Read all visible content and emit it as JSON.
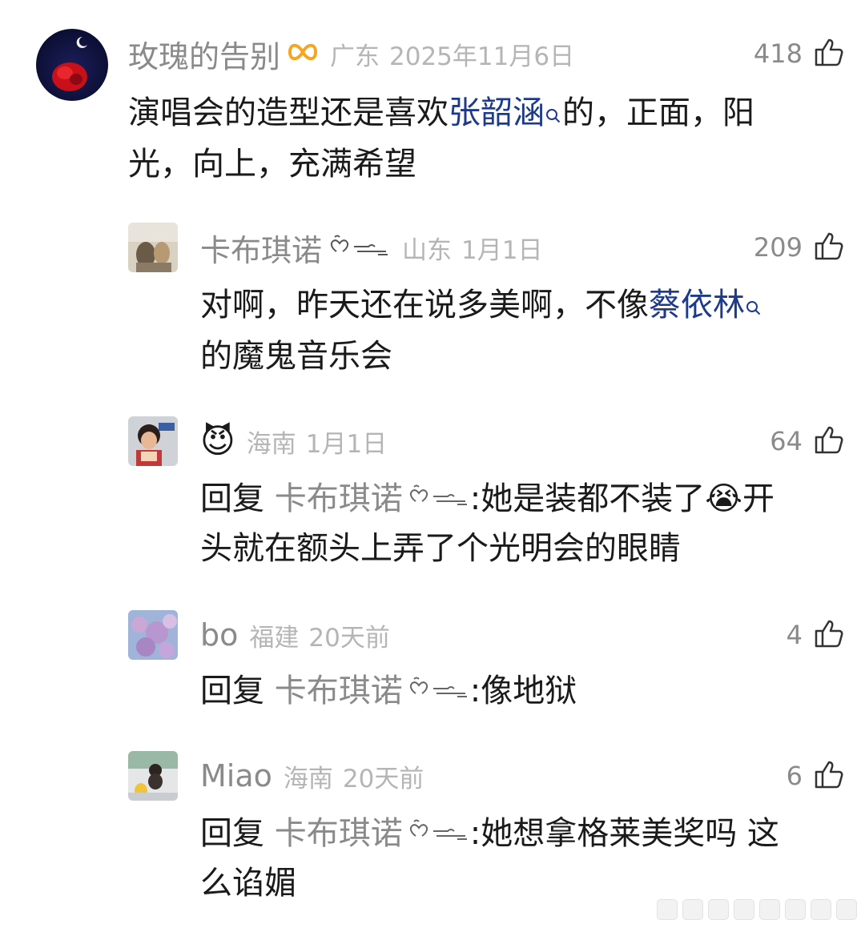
{
  "comments": [
    {
      "username": "玫瑰的告别",
      "location": "广东",
      "date": "2025年11月6日",
      "likes": "418",
      "text_before": "演唱会的造型还是喜欢",
      "mention": "张韶涵",
      "text_after": "的，正面，阳",
      "text_line2": "光，向上，充满希望"
    },
    {
      "username": "卡布琪诺",
      "location": "山东",
      "date": "1月1日",
      "likes": "209",
      "text_before": "对啊，昨天还在说多美啊，不像",
      "mention": "蔡依林",
      "text_line2": "的魔鬼音乐会"
    },
    {
      "username": "😈",
      "location": "海南",
      "date": "1月1日",
      "likes": "64",
      "reply_word": "回复",
      "reply_to": "卡布琪诺",
      "text_before": ":她是装都不装了",
      "emoji": "😭",
      "text_after": "开",
      "text_line2": "头就在额头上弄了个光明会的眼睛"
    },
    {
      "username": "bo",
      "location": "福建",
      "date": "20天前",
      "likes": "4",
      "reply_word": "回复",
      "reply_to": "卡布琪诺",
      "text_before": ":像地狱"
    },
    {
      "username": "Miao",
      "location": "海南",
      "date": "20天前",
      "likes": "6",
      "reply_word": "回复",
      "reply_to": "卡布琪诺",
      "text_before": ":她想拿格莱美奖吗 这",
      "text_line2": "么谄媚"
    }
  ],
  "colors": {
    "mention": "#1e3a8a",
    "muted": "#8a8a8a",
    "light": "#b5b5b5",
    "badge_orange": "#f5a623"
  },
  "icons": {
    "like": "thumbs-up-icon",
    "search": "search-icon",
    "badge": "infinity-badge-icon",
    "user_badge": "heart-wave-icon"
  }
}
